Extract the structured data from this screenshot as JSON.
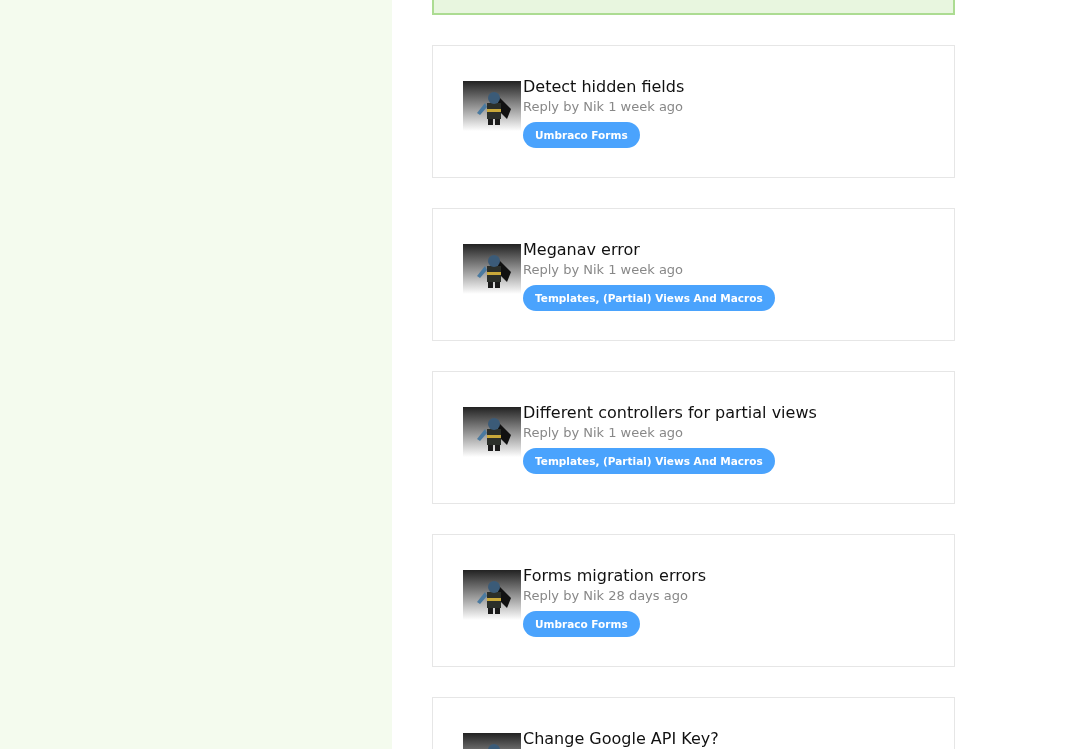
{
  "posts": [
    {
      "title": "Detect hidden fields",
      "meta": "Reply by Nik 1 week ago",
      "tag": "Umbraco Forms"
    },
    {
      "title": "Meganav error",
      "meta": "Reply by Nik 1 week ago",
      "tag": "Templates, (Partial) Views And Macros"
    },
    {
      "title": "Different controllers for partial views",
      "meta": "Reply by Nik 1 week ago",
      "tag": "Templates, (Partial) Views And Macros"
    },
    {
      "title": "Forms migration errors",
      "meta": "Reply by Nik 28 days ago",
      "tag": "Umbraco Forms"
    },
    {
      "title": "Change Google API Key?"
    }
  ]
}
